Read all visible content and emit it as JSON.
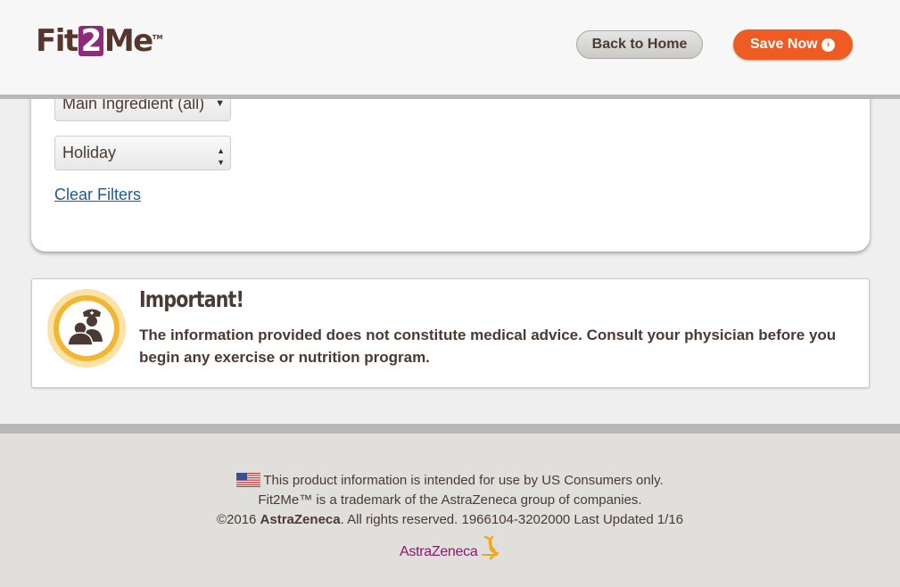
{
  "header": {
    "logo": {
      "part1": "Fit",
      "part2": "2",
      "part3": "Me",
      "tm": "TM"
    },
    "back_home_label": "Back to Home",
    "save_now_label": "Save Now"
  },
  "filters": {
    "main_ingredient_value": "Main Ingredient (all)",
    "holiday_value": "Holiday",
    "clear_label": "Clear Filters"
  },
  "important": {
    "title": "Important!",
    "text": "The information provided does not constitute medical advice. Consult your physician before you begin any exercise or nutrition program."
  },
  "footer": {
    "line1": "This product information is intended for use by US Consumers only.",
    "line2": "Fit2Me™ is a trademark of the AstraZeneca group of companies.",
    "line3_prefix": "©2016 ",
    "line3_company": "AstraZeneca",
    "line3_suffix": ". All rights reserved. 1966104-3202000 Last Updated 1/16",
    "brand_logo": "AstraZeneca"
  },
  "colors": {
    "accent": "#ee5c24",
    "brand_purple": "#8c2a7c",
    "text_brown": "#4a3a33",
    "link_blue": "#1f5a8c",
    "icon_gold": "#f2b632"
  },
  "icons": [
    "chevron-right-circle-icon",
    "caret-down-icon",
    "select-arrows-icon",
    "doctor-patient-icon",
    "us-flag-icon",
    "astrazeneca-logo"
  ]
}
